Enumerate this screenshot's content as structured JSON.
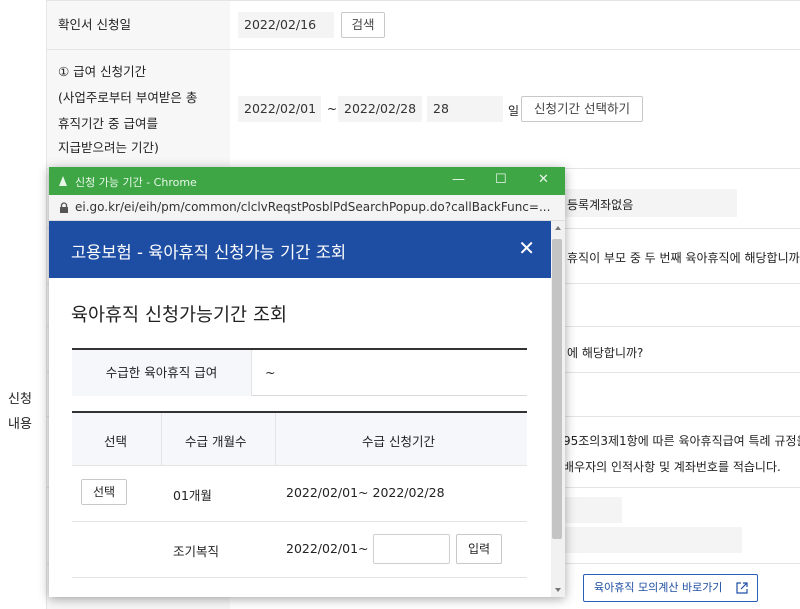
{
  "form": {
    "side_label_1": "신청",
    "side_label_2": "내용",
    "cert_date_label": "확인서 신청일",
    "cert_date_value": "2022/02/16",
    "search_button": "검색",
    "period_label_lines": [
      "① 급여 신청기간",
      "(사업주로부터 부여받은 총",
      "휴직기간 중 급여를",
      "지급받으려는 기간)"
    ],
    "period_start": "2022/02/01",
    "period_tilde": "~",
    "period_end": "2022/02/28",
    "period_days": "28",
    "period_unit": "일",
    "period_select_button": "신청기간 선택하기",
    "account_text": "등록계좌없음",
    "question_1": "휴직이 부모 중 두 번째 육아휴직에 해당합니까",
    "question_2": "에 해당합니까?",
    "question_3_line1": "95조의3제1항에 따른 육아휴직급여 특례 규정을",
    "question_3_line2": "배우자의 인적사항 및 계좌번호를 적습니다.",
    "simulate_button": "육아휴직 모의계산 바로가기",
    "external_link_icon": "external-link-icon"
  },
  "popup": {
    "window_title": "신청 가능 기간 - Chrome",
    "window_controls": {
      "minimize": "—",
      "maximize": "☐",
      "close": "✕"
    },
    "url": "ei.go.kr/ei/eih/pm/common/clclvReqstPosblPdSearchPopup.do?callBackFunc=...",
    "banner_title": "고용보험 - 육아휴직 신청가능 기간 조회",
    "banner_close": "✕",
    "section_title": "육아휴직 신청가능기간 조회",
    "received_label": "수급한 육아휴직 급여",
    "received_value": "~",
    "table_headers": [
      "선택",
      "수급 개월수",
      "수급 신청기간"
    ],
    "rows": [
      {
        "select_button": "선택",
        "months": "01개월",
        "period": "2022/02/01~ 2022/02/28"
      },
      {
        "select_button": "",
        "months": "조기복직",
        "period": "2022/02/01~",
        "input_button": "입력"
      }
    ],
    "colors": {
      "titlebar": "#3fa646",
      "banner": "#1e4ea3"
    }
  }
}
